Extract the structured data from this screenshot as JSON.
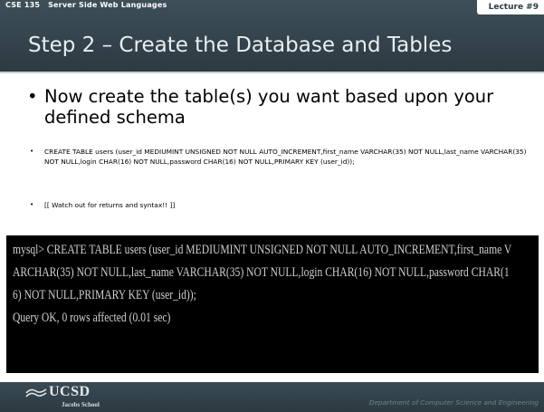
{
  "header": {
    "course": "CSE 135   Server Side Web Languages",
    "lecture": "Lecture #9",
    "title": "Step 2 – Create the Database and Tables"
  },
  "bullets": {
    "main": "Now create the table(s) you want based upon your defined schema",
    "sql": "CREATE TABLE users (user_id MEDIUMINT UNSIGNED NOT NULL AUTO_INCREMENT,first_name VARCHAR(35) NOT NULL,last_name VARCHAR(35) NOT NULL,login CHAR(16) NOT NULL,password CHAR(16) NOT NULL,PRIMARY KEY (user_id));",
    "note": "[[ Watch out for returns and syntax!! ]]",
    "dot": "•"
  },
  "terminal": {
    "lines": [
      "mysql> CREATE TABLE users (user_id MEDIUMINT UNSIGNED NOT NULL AUTO_INCREMENT,first_name V",
      "ARCHAR(35) NOT NULL,last_name VARCHAR(35) NOT NULL,login CHAR(16) NOT NULL,password CHAR(1",
      "6) NOT NULL,PRIMARY KEY (user_id));",
      "Query OK, 0 rows affected (0.01 sec)"
    ]
  },
  "footer": {
    "logo_name": "UCSD",
    "logo_school": "Jacobs School",
    "department": "Department of Computer Science and Engineering"
  },
  "colors": {
    "header_bg": "#34434c",
    "title_text": "#e9eef1",
    "terminal_bg": "#000000",
    "terminal_text": "#cfcfcf",
    "footer_text": "#70828c"
  }
}
